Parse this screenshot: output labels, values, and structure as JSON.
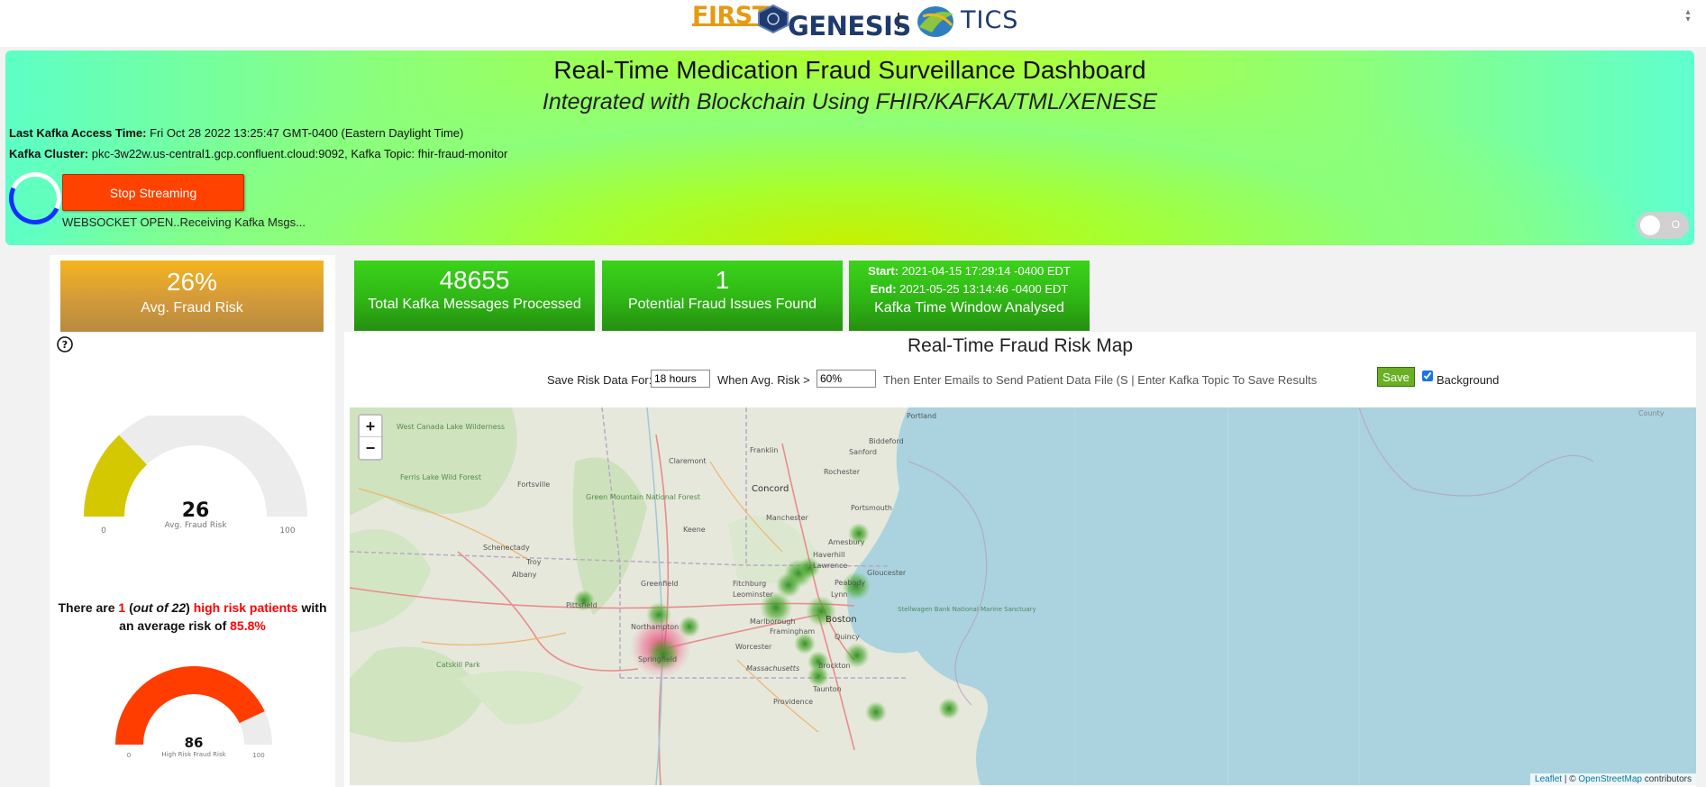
{
  "logos": {
    "first": "FIRST",
    "genesis": "GENESIS",
    "tics": "TICS"
  },
  "hero": {
    "title": "Real-Time Medication Fraud Surveillance Dashboard",
    "subtitle": "Integrated with Blockchain Using FHIR/KAFKA/TML/XENESE",
    "kafka_access_label": "Last Kafka Access Time:",
    "kafka_access_value": "Fri Oct 28 2022 13:25:47 GMT-0400 (Eastern Daylight Time)",
    "kafka_cluster_label": "Kafka Cluster:",
    "kafka_cluster_value": "pkc-3w22w.us-central1.gcp.confluent.cloud:9092, Kafka Topic: fhir-fraud-monitor",
    "stop_button": "Stop Streaming",
    "ws_status": "WEBSOCKET OPEN..Receiving Kafka Msgs...",
    "toggle_label": "O"
  },
  "risk_card": {
    "value": "26%",
    "label": "Avg. Fraud Risk"
  },
  "gauge1": {
    "value": 26,
    "min": "0",
    "max": "100",
    "label": "Avg. Fraud Risk",
    "value_text": "26",
    "fill_color": "#d4c800"
  },
  "high_risk": {
    "prefix": "There are ",
    "count": "1",
    "open_paren": " (",
    "out_of": "out of 22",
    "close_paren": ") ",
    "phrase": "high risk patients",
    "middle": " with an average risk of ",
    "avg": "85.8%"
  },
  "gauge2": {
    "value": 86,
    "min": "0",
    "max": "100",
    "label": "High Risk Fraud Risk",
    "value_text": "86",
    "fill_color": "#ff3d00"
  },
  "kpis": [
    {
      "value": "48655",
      "label": "Total Kafka Messages Processed"
    },
    {
      "value": "1",
      "label": "Potential Fraud Issues Found"
    }
  ],
  "time_window": {
    "start_label": "Start:",
    "start_value": " 2021-04-15 17:29:14 -0400 EDT",
    "end_label": "End:",
    "end_value": " 2021-05-25 13:14:46 -0400 EDT",
    "label": "Kafka Time Window Analysed"
  },
  "map_panel": {
    "title": "Real-Time Fraud Risk Map",
    "save_for_label": "Save Risk Data For:",
    "save_for_value": "18 hours",
    "when_label": "When Avg. Risk >",
    "when_value": "60%",
    "emails_text": "Then Enter Emails to Send Patient Data File (S | Enter Kafka Topic To Save Results",
    "save_button": "Save",
    "background_label": "Background",
    "background_checked": true
  },
  "map": {
    "zoom_in": "+",
    "zoom_out": "−",
    "attribution_leaflet": "Leaflet",
    "attribution_sep": " | © ",
    "attribution_osm": "OpenStreetMap",
    "attribution_tail": " contributors",
    "place_labels": [
      "Portland",
      "Biddeford",
      "Sanford",
      "Rochester",
      "Franklin",
      "Concord",
      "Claremont",
      "West Canada Lake Wilderness",
      "Ferris Lake Wild Forest",
      "Fortsville",
      "Green Mountain National Forest",
      "Keene",
      "Manchester",
      "Portsmouth",
      "Amesbury",
      "Haverhill",
      "Lawrence",
      "Gloucester",
      "Peabody",
      "Lynn",
      "Boston",
      "Schenectady",
      "Troy",
      "Albany",
      "Greenfield",
      "Fitchburg",
      "Leominster",
      "Marlborough",
      "Framingham",
      "Quincy",
      "Brockton",
      "Taunton",
      "Providence",
      "Pittsfield",
      "Northampton",
      "Springfield",
      "Worcester",
      "Massachusetts",
      "Catskill Park",
      "Stellwagen Bank National Marine Sanctuary",
      "County"
    ]
  }
}
